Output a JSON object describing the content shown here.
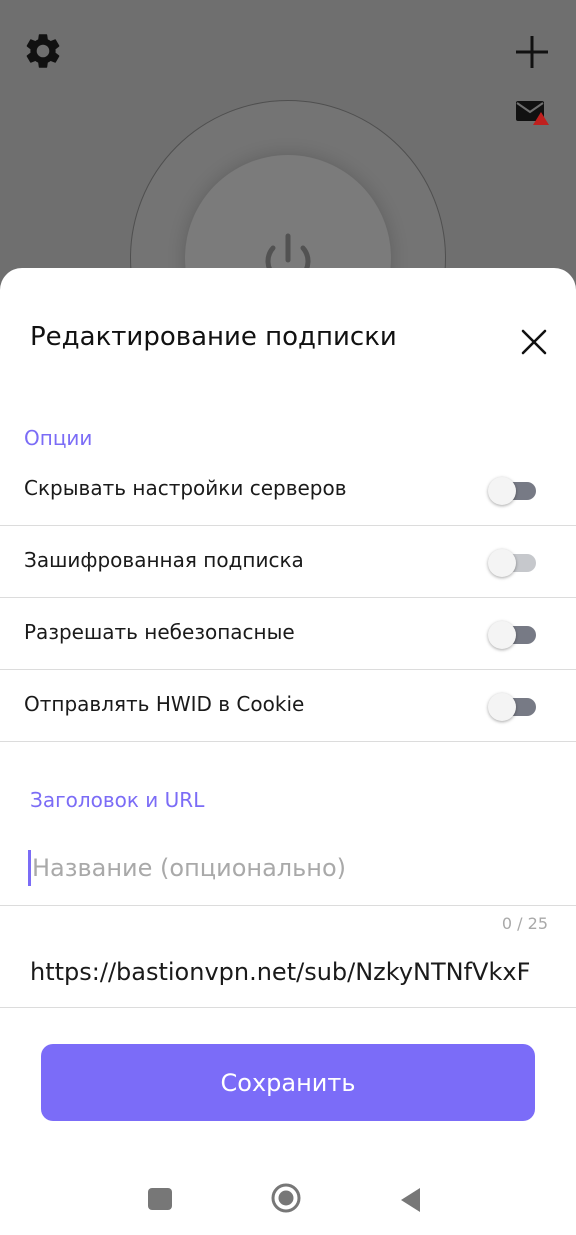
{
  "header": {
    "settings_icon": "gear-icon",
    "add_icon": "plus-icon",
    "mail_icon": "mail-alert-icon",
    "power_icon": "power-icon"
  },
  "sheet": {
    "title": "Редактирование подписки",
    "close_icon": "close-icon",
    "options_label": "Опции",
    "options": [
      {
        "label": "Скрывать настройки серверов",
        "enabled": false
      },
      {
        "label": "Зашифрованная подписка",
        "enabled": false
      },
      {
        "label": "Разрешать небезопасные",
        "enabled": false
      },
      {
        "label": "Отправлять HWID в Cookie",
        "enabled": false
      }
    ],
    "title_url_label": "Заголовок и URL",
    "name_field": {
      "value": "",
      "placeholder": "Название (опционально)",
      "counter": "0 / 25"
    },
    "url_field": {
      "value": "https://bastionvpn.net/sub/NzkyNTNfVkxF"
    },
    "save_label": "Сохранить"
  },
  "nav": {
    "recents_icon": "square-icon",
    "home_icon": "home-circle-icon",
    "back_icon": "back-triangle-icon"
  },
  "colors": {
    "accent": "#7b6cf8",
    "section_label": "#7b6cf6",
    "scrim": "#6f6f6f"
  }
}
